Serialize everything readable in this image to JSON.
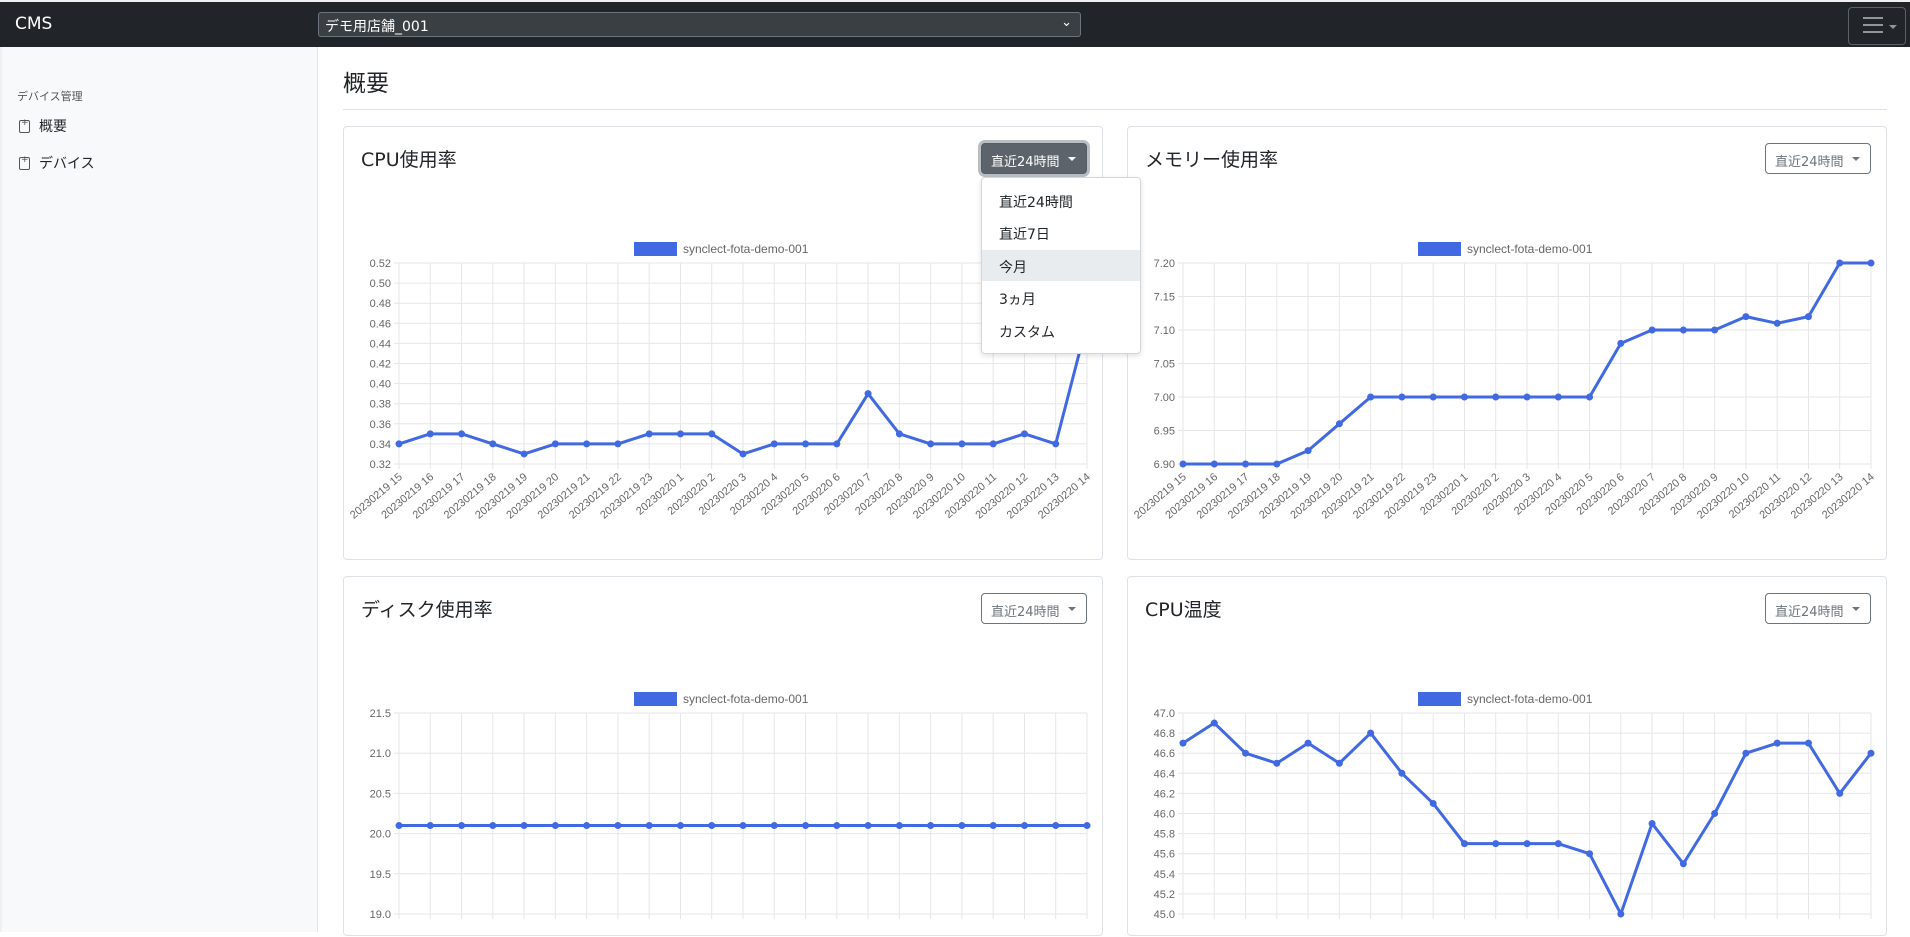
{
  "app": {
    "brand": "CMS"
  },
  "store_select": {
    "value": "デモ用店舗_001"
  },
  "sidebar": {
    "section": "デバイス管理",
    "items": [
      {
        "label": "概要"
      },
      {
        "label": "デバイス"
      }
    ]
  },
  "page": {
    "title": "概要"
  },
  "dropdown": {
    "options": [
      "直近24時間",
      "直近7日",
      "今月",
      "3ヵ月",
      "カスタム"
    ],
    "highlighted": "今月"
  },
  "colors": {
    "series": "#4169e1",
    "topbar": "#212529"
  },
  "cards": [
    {
      "title": "CPU使用率",
      "range_label": "直近24時間",
      "active": true
    },
    {
      "title": "メモリー使用率",
      "range_label": "直近24時間",
      "active": false
    },
    {
      "title": "ディスク使用率",
      "range_label": "直近24時間",
      "active": false
    },
    {
      "title": "CPU温度",
      "range_label": "直近24時間",
      "active": false
    }
  ],
  "chart_data": [
    {
      "type": "line",
      "title": "CPU使用率",
      "categories": [
        "20230219 15",
        "20230219 16",
        "20230219 17",
        "20230219 18",
        "20230219 19",
        "20230219 20",
        "20230219 21",
        "20230219 22",
        "20230219 23",
        "20230220 1",
        "20230220 2",
        "20230220 3",
        "20230220 4",
        "20230220 5",
        "20230220 6",
        "20230220 7",
        "20230220 8",
        "20230220 9",
        "20230220 10",
        "20230220 11",
        "20230220 12",
        "20230220 13",
        "20230220 14"
      ],
      "series": [
        {
          "name": "synclect-fota-demo-001",
          "values": [
            0.34,
            0.35,
            0.35,
            0.34,
            0.33,
            0.34,
            0.34,
            0.34,
            0.35,
            0.35,
            0.35,
            0.33,
            0.34,
            0.34,
            0.34,
            0.39,
            0.35,
            0.34,
            0.34,
            0.34,
            0.35,
            0.34,
            0.46
          ]
        }
      ],
      "yticks": [
        0.32,
        0.34,
        0.36,
        0.38,
        0.4,
        0.42,
        0.44,
        0.46,
        0.48,
        0.5,
        0.52
      ],
      "ylim": [
        0.32,
        0.52
      ],
      "grid": true,
      "legend": "top"
    },
    {
      "type": "line",
      "title": "メモリー使用率",
      "categories": [
        "20230219 15",
        "20230219 16",
        "20230219 17",
        "20230219 18",
        "20230219 19",
        "20230219 20",
        "20230219 21",
        "20230219 22",
        "20230219 23",
        "20230220 1",
        "20230220 2",
        "20230220 3",
        "20230220 4",
        "20230220 5",
        "20230220 6",
        "20230220 7",
        "20230220 8",
        "20230220 9",
        "20230220 10",
        "20230220 11",
        "20230220 12",
        "20230220 13",
        "20230220 14"
      ],
      "series": [
        {
          "name": "synclect-fota-demo-001",
          "values": [
            6.9,
            6.9,
            6.9,
            6.9,
            6.92,
            6.96,
            7.0,
            7.0,
            7.0,
            7.0,
            7.0,
            7.0,
            7.0,
            7.0,
            7.08,
            7.1,
            7.1,
            7.1,
            7.12,
            7.11,
            7.12,
            7.2,
            7.2
          ]
        }
      ],
      "yticks": [
        6.9,
        6.95,
        7.0,
        7.05,
        7.1,
        7.15,
        7.2
      ],
      "ylim": [
        6.9,
        7.2
      ],
      "grid": true,
      "legend": "top"
    },
    {
      "type": "line",
      "title": "ディスク使用率",
      "categories": [
        "",
        "",
        "",
        "",
        "",
        "",
        "",
        "",
        "",
        "",
        "",
        "",
        "",
        "",
        "",
        "",
        "",
        "",
        "",
        "",
        "",
        "",
        ""
      ],
      "series": [
        {
          "name": "synclect-fota-demo-001",
          "values": [
            20.1,
            20.1,
            20.1,
            20.1,
            20.1,
            20.1,
            20.1,
            20.1,
            20.1,
            20.1,
            20.1,
            20.1,
            20.1,
            20.1,
            20.1,
            20.1,
            20.1,
            20.1,
            20.1,
            20.1,
            20.1,
            20.1,
            20.1
          ]
        }
      ],
      "yticks": [
        19.0,
        19.5,
        20.0,
        20.5,
        21.0,
        21.5
      ],
      "ylim": [
        19.0,
        21.5
      ],
      "grid": true,
      "legend": "top"
    },
    {
      "type": "line",
      "title": "CPU温度",
      "categories": [
        "",
        "",
        "",
        "",
        "",
        "",
        "",
        "",
        "",
        "",
        "",
        "",
        "",
        "",
        "",
        "",
        "",
        "",
        "",
        "",
        "",
        "",
        ""
      ],
      "series": [
        {
          "name": "synclect-fota-demo-001",
          "values": [
            46.7,
            46.9,
            46.6,
            46.5,
            46.7,
            46.5,
            46.8,
            46.4,
            46.1,
            45.7,
            45.7,
            45.7,
            45.7,
            45.6,
            45.0,
            45.9,
            45.5,
            46.0,
            46.6,
            46.7,
            46.7,
            46.2,
            46.6
          ]
        }
      ],
      "yticks": [
        45.0,
        45.2,
        45.4,
        45.6,
        45.8,
        46.0,
        46.2,
        46.4,
        46.6,
        46.8,
        47.0
      ],
      "ylim": [
        45.0,
        47.0
      ],
      "grid": true,
      "legend": "top"
    }
  ]
}
